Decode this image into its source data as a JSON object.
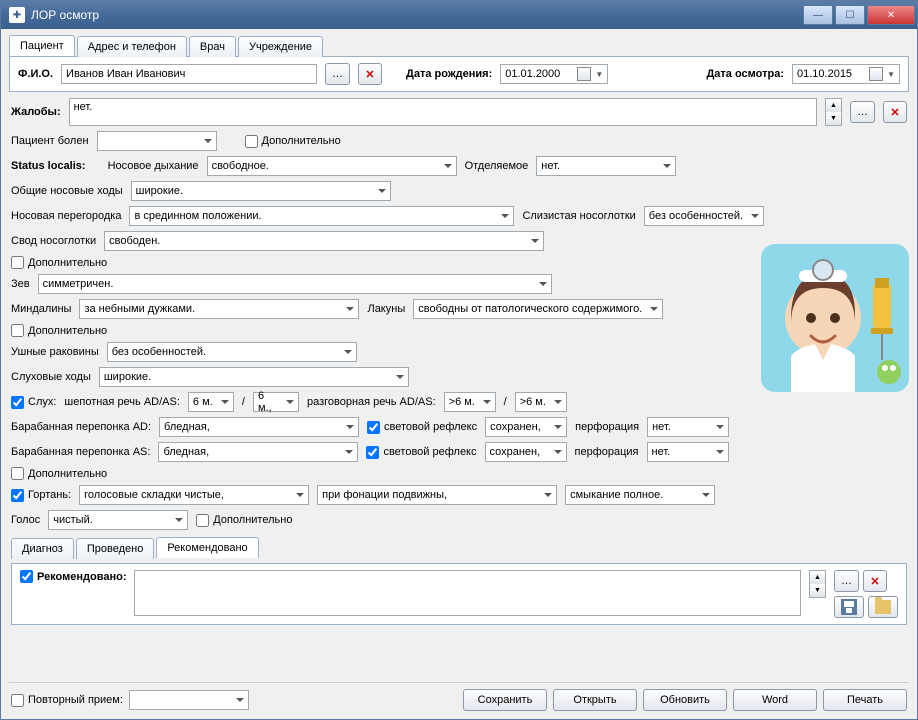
{
  "window_title": "ЛОР осмотр",
  "main_tabs": [
    "Пациент",
    "Адрес и телефон",
    "Врач",
    "Учреждение"
  ],
  "main_tab_active": 0,
  "fio_label": "Ф.И.О.",
  "fio_value": "Иванов Иван Иванович",
  "dob_label": "Дата рождения:",
  "dob_value": "01.01.2000",
  "exam_date_label": "Дата осмотра:",
  "exam_date_value": "01.10.2015",
  "complaints_label": "Жалобы:",
  "complaints_value": "нет.",
  "patient_ill_label": "Пациент болен",
  "patient_ill_value": "",
  "additional_label": "Дополнительно",
  "status_localis_label": "Status localis:",
  "nasal_breathing_label": "Носовое дыхание",
  "nasal_breathing_value": "свободное.",
  "discharge_label": "Отделяемое",
  "discharge_value": "нет.",
  "nasal_passages_label": "Общие носовые ходы",
  "nasal_passages_value": "широкие.",
  "septum_label": "Носовая перегородка",
  "septum_value": "в срединном положении.",
  "mucosa_label": "Слизистая носоглотки",
  "mucosa_value": "без особенностей.",
  "fornix_label": "Свод носоглотки",
  "fornix_value": "свободен.",
  "fauces_label": "Зев",
  "fauces_value": "симметричен.",
  "tonsils_label": "Миндалины",
  "tonsils_value": "за небными дужками.",
  "lacunae_label": "Лакуны",
  "lacunae_value": "свободны от патологического содержимого.",
  "auricles_label": "Ушные раковины",
  "auricles_value": "без особенностей.",
  "ear_canals_label": "Слуховые ходы",
  "ear_canals_value": "широкие.",
  "hearing_label": "Слух:",
  "whisper_label": "шепотная речь AD/AS:",
  "whisper_ad": "6 м.",
  "whisper_as": "6 м.,",
  "slash": "/",
  "speech_label": "разговорная речь AD/AS:",
  "speech_ad": ">6 м.",
  "speech_as": ">6 м.",
  "eardrum_ad_label": "Барабанная перепонка AD:",
  "eardrum_ad_value": "бледная,",
  "eardrum_as_label": "Барабанная перепонка AS:",
  "eardrum_as_value": "бледная,",
  "light_reflex_label": "световой рефлекс",
  "light_reflex_value": "сохранен,",
  "perforation_label": "перфорация",
  "perforation_value": "нет.",
  "larynx_label": "Гортань:",
  "vocal_folds_value": "голосовые складки чистые,",
  "phonation_value": "при фонации подвижны,",
  "closure_value": "смыкание полное.",
  "voice_label": "Голос",
  "voice_value": "чистый.",
  "bottom_tabs": [
    "Диагноз",
    "Проведено",
    "Рекомендовано"
  ],
  "bottom_tab_active": 2,
  "recommended_label": "Рекомендовано:",
  "recommended_value": "",
  "repeat_label": "Повторный прием:",
  "buttons": {
    "save": "Сохранить",
    "open": "Открыть",
    "refresh": "Обновить",
    "word": "Word",
    "print": "Печать"
  }
}
